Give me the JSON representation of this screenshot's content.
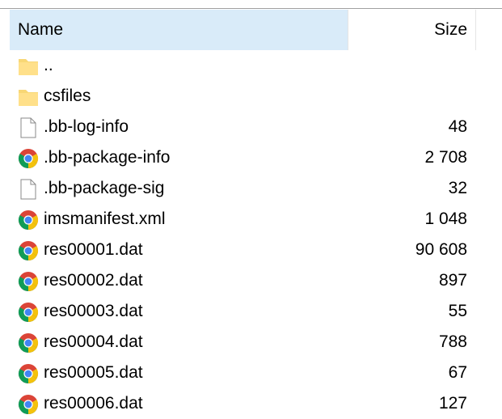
{
  "header": {
    "name_label": "Name",
    "size_label": "Size"
  },
  "rows": [
    {
      "name": "..",
      "size": "",
      "icon": "folder-icon"
    },
    {
      "name": "csfiles",
      "size": "",
      "icon": "folder-icon"
    },
    {
      "name": ".bb-log-info",
      "size": "48",
      "icon": "file-icon"
    },
    {
      "name": ".bb-package-info",
      "size": "2 708",
      "icon": "chrome-icon"
    },
    {
      "name": ".bb-package-sig",
      "size": "32",
      "icon": "file-icon"
    },
    {
      "name": "imsmanifest.xml",
      "size": "1 048",
      "icon": "chrome-icon"
    },
    {
      "name": "res00001.dat",
      "size": "90 608",
      "icon": "chrome-icon"
    },
    {
      "name": "res00002.dat",
      "size": "897",
      "icon": "chrome-icon"
    },
    {
      "name": "res00003.dat",
      "size": "55",
      "icon": "chrome-icon"
    },
    {
      "name": "res00004.dat",
      "size": "788",
      "icon": "chrome-icon"
    },
    {
      "name": "res00005.dat",
      "size": "67",
      "icon": "chrome-icon"
    },
    {
      "name": "res00006.dat",
      "size": "127",
      "icon": "chrome-icon"
    }
  ],
  "colors": {
    "header_highlight": "#d9ebf9",
    "folder": "#f8d775",
    "chrome_red": "#db4437",
    "chrome_yellow": "#f4c20d",
    "chrome_green": "#0f9d58",
    "chrome_blue": "#4285f4"
  }
}
